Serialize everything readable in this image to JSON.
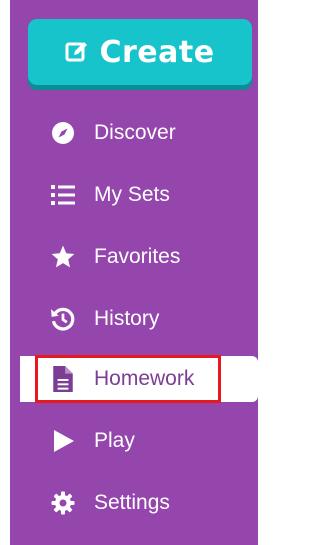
{
  "create_button": {
    "label": "Create",
    "icon": "edit-icon"
  },
  "nav": {
    "items": [
      {
        "label": "Discover",
        "icon": "compass-icon"
      },
      {
        "label": "My Sets",
        "icon": "list-icon"
      },
      {
        "label": "Favorites",
        "icon": "star-icon"
      },
      {
        "label": "History",
        "icon": "history-icon"
      },
      {
        "label": "Homework",
        "icon": "document-icon",
        "active": true,
        "highlighted": true
      },
      {
        "label": "Play",
        "icon": "play-icon"
      },
      {
        "label": "Settings",
        "icon": "gear-icon"
      }
    ]
  },
  "colors": {
    "sidebar_bg": "#9546ad",
    "create_bg": "#17c4cc",
    "active_text": "#7b3e94",
    "highlight_border": "#e8191d"
  }
}
